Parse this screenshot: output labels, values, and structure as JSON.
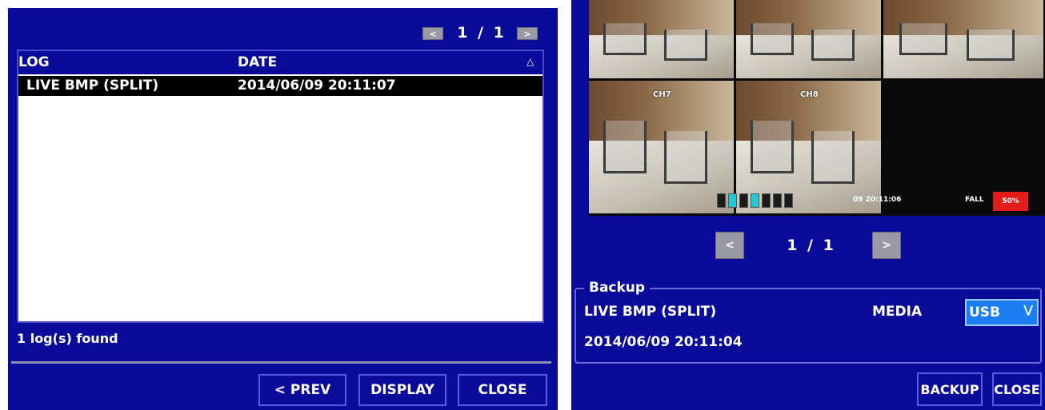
{
  "left": {
    "pager": {
      "text": "1 / 1",
      "prev_glyph": "<",
      "next_glyph": ">"
    },
    "table": {
      "headers": {
        "log": "LOG",
        "date": "DATE"
      },
      "rows": [
        {
          "log": "LIVE BMP (SPLIT)",
          "date": "2014/06/09 20:11:07"
        }
      ]
    },
    "count_text": "1 log(s) found",
    "buttons": {
      "prev": "< PREV",
      "display": "DISPLAY",
      "close": "CLOSE"
    }
  },
  "right": {
    "preview": {
      "cameras": [
        {
          "label": ""
        },
        {
          "label": ""
        },
        {
          "label": ""
        },
        {
          "label": "CH7"
        },
        {
          "label": "CH8"
        }
      ],
      "status": {
        "time": "09 20:11:06",
        "fall": "FALL",
        "hdd": "50%"
      }
    },
    "pager": {
      "text": "1 / 1",
      "prev_glyph": "<",
      "next_glyph": ">"
    },
    "backup": {
      "legend": "Backup",
      "name": "LIVE BMP (SPLIT)",
      "date": "2014/06/09 20:11:04",
      "media_label": "MEDIA",
      "media_value": "USB"
    },
    "buttons": {
      "backup": "BACKUP",
      "close": "CLOSE"
    }
  },
  "colors": {
    "panel_bg": "#0b0b9a",
    "selected_row": "#000000",
    "media_select": "#1c7ef2",
    "hdd_indicator": "#e21b1b"
  }
}
